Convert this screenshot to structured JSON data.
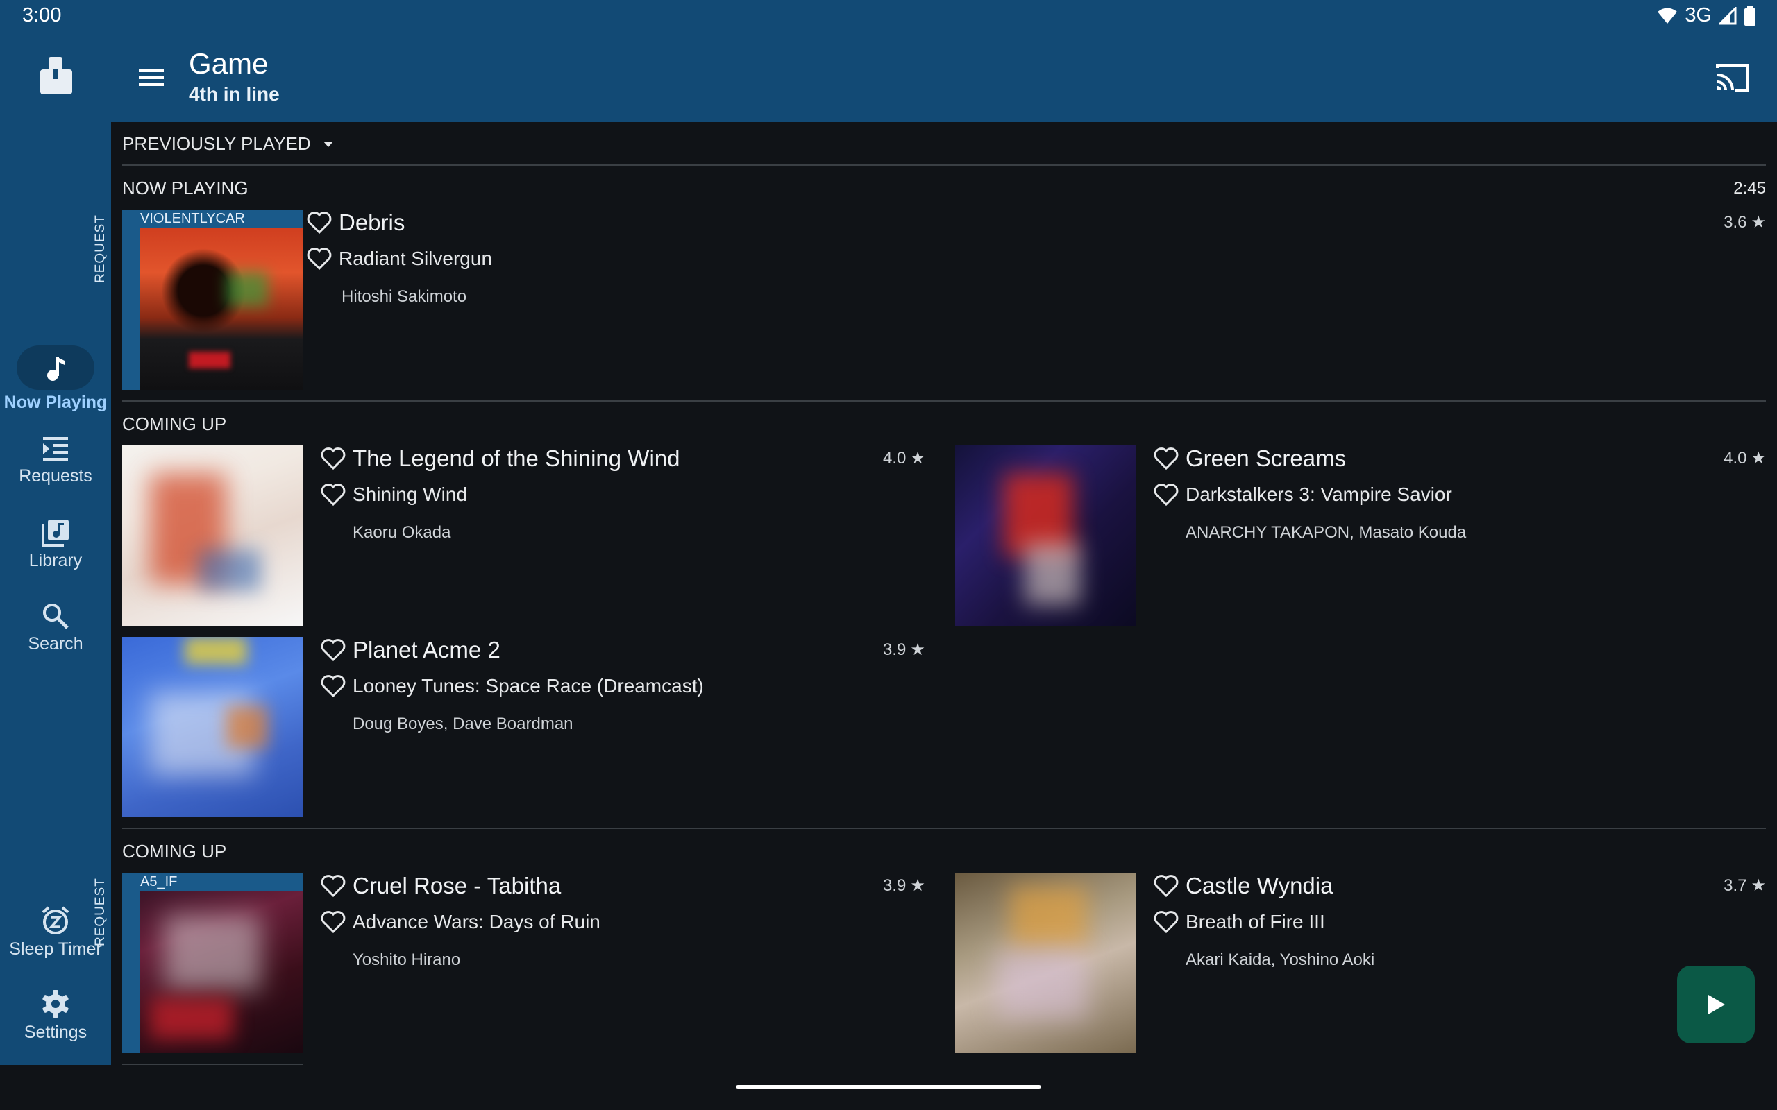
{
  "status_bar": {
    "time": "3:00",
    "network": "3G"
  },
  "topbar": {
    "title": "Game",
    "subtitle": "4th in line"
  },
  "rail": {
    "items": [
      {
        "label": "Now Playing",
        "icon": "music-note-icon"
      },
      {
        "label": "Requests",
        "icon": "queue-list-icon"
      },
      {
        "label": "Library",
        "icon": "library-music-icon"
      },
      {
        "label": "Search",
        "icon": "search-icon"
      }
    ],
    "bottom": [
      {
        "label": "Sleep Timer",
        "icon": "snooze-alarm-icon"
      },
      {
        "label": "Settings",
        "icon": "gear-icon"
      }
    ]
  },
  "previously_played": {
    "label": "PREVIOUSLY PLAYED"
  },
  "now_playing": {
    "heading": "NOW PLAYING",
    "elapsed": "2:45",
    "song": {
      "title": "Debris",
      "album": "Radiant Silvergun",
      "artist": "Hitoshi Sakimoto",
      "rating": "3.6",
      "request_label": "REQUEST",
      "requester": "VIOLENTLYCAR"
    }
  },
  "coming_up_1": {
    "heading": "COMING UP",
    "songs": [
      {
        "title": "The Legend of the Shining Wind",
        "album": "Shining Wind",
        "artist": "Kaoru Okada",
        "rating": "4.0"
      },
      {
        "title": "Green Screams",
        "album": "Darkstalkers 3: Vampire Savior",
        "artist": "ANARCHY TAKAPON, Masato Kouda",
        "rating": "4.0"
      },
      {
        "title": "Planet Acme 2",
        "album": "Looney Tunes: Space Race (Dreamcast)",
        "artist": "Doug Boyes, Dave Boardman",
        "rating": "3.9"
      }
    ]
  },
  "coming_up_2": {
    "heading": "COMING UP",
    "songs": [
      {
        "title": "Cruel Rose - Tabitha",
        "album": "Advance Wars: Days of Ruin",
        "artist": "Yoshito Hirano",
        "rating": "3.9",
        "request_label": "REQUEST",
        "requester": "A5_IF"
      },
      {
        "title": "Castle Wyndia",
        "album": "Breath of Fire III",
        "artist": "Akari Kaida, Yoshino Aoki",
        "rating": "3.7"
      }
    ]
  },
  "star_glyph": "★",
  "colors": {
    "appbar": "#124a75",
    "background": "#101317",
    "fab": "#0b5946",
    "accent": "#9fd1ff"
  }
}
